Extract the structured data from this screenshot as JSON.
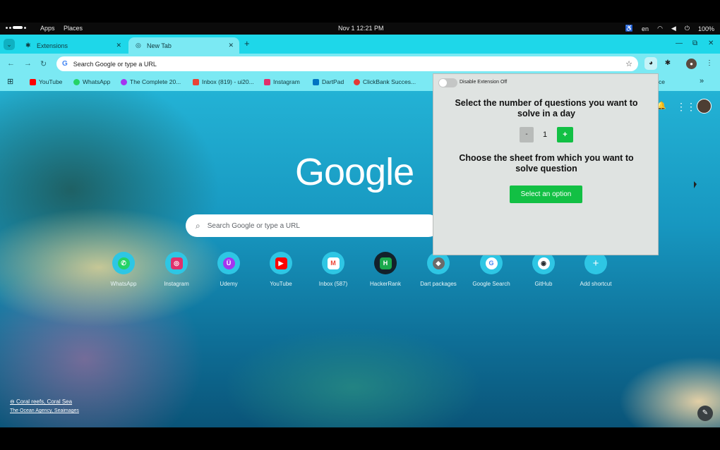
{
  "system_bar": {
    "apps": "Apps",
    "places": "Places",
    "clock": "Nov 1  12:21 PM",
    "lang": "en",
    "battery": "100%"
  },
  "tabs": [
    {
      "label": "Extensions",
      "icon": "puzzle-icon"
    },
    {
      "label": "New Tab",
      "icon": "chrome-icon"
    }
  ],
  "omnibox": {
    "placeholder": "Search Google or type a URL"
  },
  "bookmarks": [
    {
      "label": "YouTube",
      "color": "#ff0000"
    },
    {
      "label": "WhatsApp",
      "color": "#25d366"
    },
    {
      "label": "The Complete 20...",
      "color": "#a435f0"
    },
    {
      "label": "Inbox (819) - ui20...",
      "color": "#ea4335"
    },
    {
      "label": "Instagram",
      "color": "#e1306c"
    },
    {
      "label": "DartPad",
      "color": "#0175c2"
    },
    {
      "label": "ClickBank Succes...",
      "color": "#e53935"
    }
  ],
  "bookmarks_overflow_tail": "ce",
  "ntp": {
    "logo": "Google",
    "search_placeholder": "Search Google or type a URL",
    "shortcuts": [
      {
        "label": "WhatsApp",
        "glyph": "✆",
        "color": "#25d366"
      },
      {
        "label": "Instagram",
        "glyph": "◎",
        "color": "#e1306c"
      },
      {
        "label": "Udemy",
        "glyph": "Ü",
        "color": "#a435f0"
      },
      {
        "label": "YouTube",
        "glyph": "▶",
        "color": "#ff0000"
      },
      {
        "label": "Inbox (587)",
        "glyph": "M",
        "color": "#ea4335"
      },
      {
        "label": "HackerRank",
        "glyph": "H",
        "color": "#1ba94c"
      },
      {
        "label": "Dart packages",
        "glyph": "◆",
        "color": "#6b6b6b"
      },
      {
        "label": "Google Search",
        "glyph": "G",
        "color": "#4285f4"
      },
      {
        "label": "GitHub",
        "glyph": "◉",
        "color": "#24292e"
      },
      {
        "label": "Add shortcut",
        "glyph": "+",
        "color": "#2ec6e4"
      }
    ],
    "attribution_title": "Coral reefs, Coral Sea",
    "attribution_author": "The Ocean Agency, Seaimages"
  },
  "popup": {
    "toggle_label": "Disable Extension Off",
    "toggle_on": false,
    "questions_title": "Select the number of questions you want to solve in a day",
    "minus": "-",
    "count": "1",
    "plus": "+",
    "sheet_title": "Choose the sheet from which you want to solve question",
    "select_label": "Select an option"
  }
}
